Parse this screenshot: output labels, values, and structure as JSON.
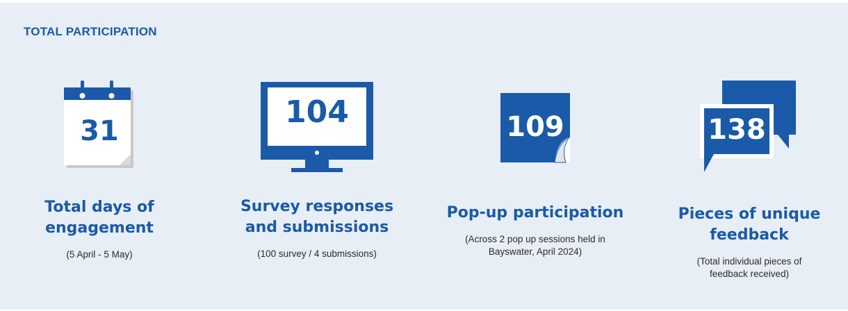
{
  "section": {
    "heading": "TOTAL PARTICIPATION"
  },
  "stats": [
    {
      "value": "31",
      "title_line1": "Total days of",
      "title_line2": "engagement",
      "note_line1": "(5 April - 5 May)",
      "note_line2": "",
      "icon": "calendar-icon"
    },
    {
      "value": "104",
      "title_line1": "Survey responses",
      "title_line2": "and submissions",
      "note_line1": "(100 survey / 4 submissions)",
      "note_line2": "",
      "icon": "monitor-icon"
    },
    {
      "value": "109",
      "title_line1": "Pop-up participation",
      "title_line2": "",
      "note_line1": "(Across 2 pop up sessions held in",
      "note_line2": "Bayswater, April 2024)",
      "icon": "page-curl-icon"
    },
    {
      "value": "138",
      "title_line1": "Pieces of unique",
      "title_line2": "feedback",
      "note_line1": "(Total individual pieces of",
      "note_line2": "feedback received)",
      "icon": "speech-bubbles-icon"
    }
  ],
  "colors": {
    "primary": "#1a5aa8",
    "panel_bg": "#e8eef5"
  }
}
